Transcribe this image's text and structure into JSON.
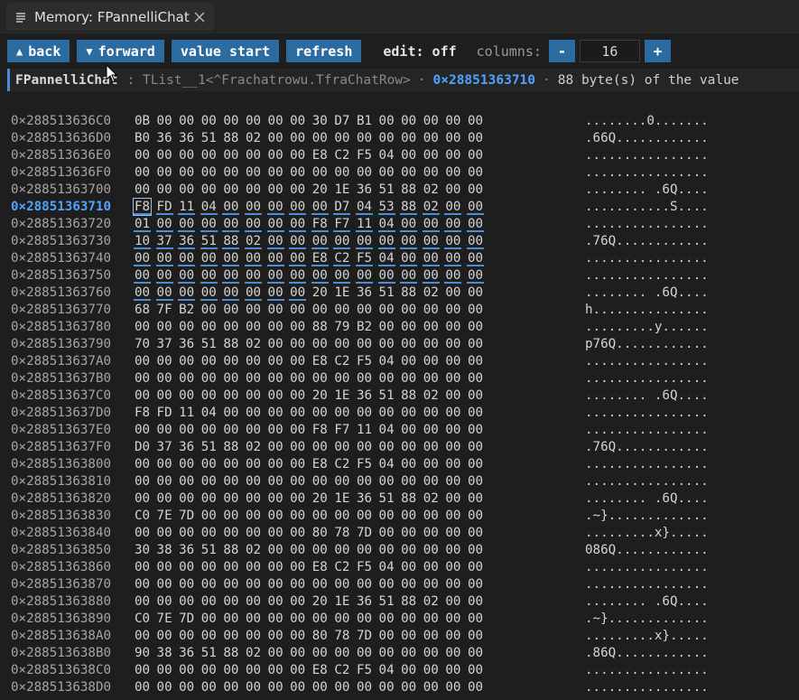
{
  "tab": {
    "title": "Memory: FPannelliChat",
    "icon": "list-icon",
    "close_icon": "close-icon"
  },
  "toolbar": {
    "back_label": "back",
    "forward_label": "forward",
    "value_start_label": "value start",
    "refresh_label": "refresh",
    "edit_label": "edit: off",
    "columns_label": "columns:",
    "columns_value": "16",
    "minus": "-",
    "plus": "+"
  },
  "infobar": {
    "name": "FPannelliChat",
    "type": ": TList__1<^Frachatrowu.TfraChatRow>",
    "address": "0×28851363710",
    "size_text": "88 byte(s) of the value",
    "dot": "·"
  },
  "colors": {
    "accent": "#2c6ba0",
    "highlight": "#4fa3ff"
  },
  "dump": {
    "current_row": 5,
    "current_byte": 0,
    "highlight_from": [
      5,
      0
    ],
    "highlight_to": [
      10,
      7
    ],
    "rows": [
      {
        "addr": "0×288513636C0",
        "bytes": [
          "0B",
          "00",
          "00",
          "00",
          "00",
          "00",
          "00",
          "00",
          "30",
          "D7",
          "B1",
          "00",
          "00",
          "00",
          "00",
          "00"
        ],
        "ascii": "........0......."
      },
      {
        "addr": "0×288513636D0",
        "bytes": [
          "B0",
          "36",
          "36",
          "51",
          "88",
          "02",
          "00",
          "00",
          "00",
          "00",
          "00",
          "00",
          "00",
          "00",
          "00",
          "00"
        ],
        "ascii": ".66Q............"
      },
      {
        "addr": "0×288513636E0",
        "bytes": [
          "00",
          "00",
          "00",
          "00",
          "00",
          "00",
          "00",
          "00",
          "E8",
          "C2",
          "F5",
          "04",
          "00",
          "00",
          "00",
          "00"
        ],
        "ascii": "................"
      },
      {
        "addr": "0×288513636F0",
        "bytes": [
          "00",
          "00",
          "00",
          "00",
          "00",
          "00",
          "00",
          "00",
          "00",
          "00",
          "00",
          "00",
          "00",
          "00",
          "00",
          "00"
        ],
        "ascii": "................"
      },
      {
        "addr": "0×28851363700",
        "bytes": [
          "00",
          "00",
          "00",
          "00",
          "00",
          "00",
          "00",
          "00",
          "20",
          "1E",
          "36",
          "51",
          "88",
          "02",
          "00",
          "00"
        ],
        "ascii": "........ .6Q...."
      },
      {
        "addr": "0×28851363710",
        "bytes": [
          "F8",
          "FD",
          "11",
          "04",
          "00",
          "00",
          "00",
          "00",
          "00",
          "D7",
          "04",
          "53",
          "88",
          "02",
          "00",
          "00"
        ],
        "ascii": "...........S...."
      },
      {
        "addr": "0×28851363720",
        "bytes": [
          "01",
          "00",
          "00",
          "00",
          "00",
          "00",
          "00",
          "00",
          "F8",
          "F7",
          "11",
          "04",
          "00",
          "00",
          "00",
          "00"
        ],
        "ascii": "................"
      },
      {
        "addr": "0×28851363730",
        "bytes": [
          "10",
          "37",
          "36",
          "51",
          "88",
          "02",
          "00",
          "00",
          "00",
          "00",
          "00",
          "00",
          "00",
          "00",
          "00",
          "00"
        ],
        "ascii": ".76Q............"
      },
      {
        "addr": "0×28851363740",
        "bytes": [
          "00",
          "00",
          "00",
          "00",
          "00",
          "00",
          "00",
          "00",
          "E8",
          "C2",
          "F5",
          "04",
          "00",
          "00",
          "00",
          "00"
        ],
        "ascii": "................"
      },
      {
        "addr": "0×28851363750",
        "bytes": [
          "00",
          "00",
          "00",
          "00",
          "00",
          "00",
          "00",
          "00",
          "00",
          "00",
          "00",
          "00",
          "00",
          "00",
          "00",
          "00"
        ],
        "ascii": "................"
      },
      {
        "addr": "0×28851363760",
        "bytes": [
          "00",
          "00",
          "00",
          "00",
          "00",
          "00",
          "00",
          "00",
          "20",
          "1E",
          "36",
          "51",
          "88",
          "02",
          "00",
          "00"
        ],
        "ascii": "........ .6Q...."
      },
      {
        "addr": "0×28851363770",
        "bytes": [
          "68",
          "7F",
          "B2",
          "00",
          "00",
          "00",
          "00",
          "00",
          "00",
          "00",
          "00",
          "00",
          "00",
          "00",
          "00",
          "00"
        ],
        "ascii": "h..............."
      },
      {
        "addr": "0×28851363780",
        "bytes": [
          "00",
          "00",
          "00",
          "00",
          "00",
          "00",
          "00",
          "00",
          "88",
          "79",
          "B2",
          "00",
          "00",
          "00",
          "00",
          "00"
        ],
        "ascii": ".........y......"
      },
      {
        "addr": "0×28851363790",
        "bytes": [
          "70",
          "37",
          "36",
          "51",
          "88",
          "02",
          "00",
          "00",
          "00",
          "00",
          "00",
          "00",
          "00",
          "00",
          "00",
          "00"
        ],
        "ascii": "p76Q............"
      },
      {
        "addr": "0×288513637A0",
        "bytes": [
          "00",
          "00",
          "00",
          "00",
          "00",
          "00",
          "00",
          "00",
          "E8",
          "C2",
          "F5",
          "04",
          "00",
          "00",
          "00",
          "00"
        ],
        "ascii": "................"
      },
      {
        "addr": "0×288513637B0",
        "bytes": [
          "00",
          "00",
          "00",
          "00",
          "00",
          "00",
          "00",
          "00",
          "00",
          "00",
          "00",
          "00",
          "00",
          "00",
          "00",
          "00"
        ],
        "ascii": "................"
      },
      {
        "addr": "0×288513637C0",
        "bytes": [
          "00",
          "00",
          "00",
          "00",
          "00",
          "00",
          "00",
          "00",
          "20",
          "1E",
          "36",
          "51",
          "88",
          "02",
          "00",
          "00"
        ],
        "ascii": "........ .6Q...."
      },
      {
        "addr": "0×288513637D0",
        "bytes": [
          "F8",
          "FD",
          "11",
          "04",
          "00",
          "00",
          "00",
          "00",
          "00",
          "00",
          "00",
          "00",
          "00",
          "00",
          "00",
          "00"
        ],
        "ascii": "................"
      },
      {
        "addr": "0×288513637E0",
        "bytes": [
          "00",
          "00",
          "00",
          "00",
          "00",
          "00",
          "00",
          "00",
          "F8",
          "F7",
          "11",
          "04",
          "00",
          "00",
          "00",
          "00"
        ],
        "ascii": "................"
      },
      {
        "addr": "0×288513637F0",
        "bytes": [
          "D0",
          "37",
          "36",
          "51",
          "88",
          "02",
          "00",
          "00",
          "00",
          "00",
          "00",
          "00",
          "00",
          "00",
          "00",
          "00"
        ],
        "ascii": ".76Q............"
      },
      {
        "addr": "0×28851363800",
        "bytes": [
          "00",
          "00",
          "00",
          "00",
          "00",
          "00",
          "00",
          "00",
          "E8",
          "C2",
          "F5",
          "04",
          "00",
          "00",
          "00",
          "00"
        ],
        "ascii": "................"
      },
      {
        "addr": "0×28851363810",
        "bytes": [
          "00",
          "00",
          "00",
          "00",
          "00",
          "00",
          "00",
          "00",
          "00",
          "00",
          "00",
          "00",
          "00",
          "00",
          "00",
          "00"
        ],
        "ascii": "................"
      },
      {
        "addr": "0×28851363820",
        "bytes": [
          "00",
          "00",
          "00",
          "00",
          "00",
          "00",
          "00",
          "00",
          "20",
          "1E",
          "36",
          "51",
          "88",
          "02",
          "00",
          "00"
        ],
        "ascii": "........ .6Q...."
      },
      {
        "addr": "0×28851363830",
        "bytes": [
          "C0",
          "7E",
          "7D",
          "00",
          "00",
          "00",
          "00",
          "00",
          "00",
          "00",
          "00",
          "00",
          "00",
          "00",
          "00",
          "00"
        ],
        "ascii": ".~}............."
      },
      {
        "addr": "0×28851363840",
        "bytes": [
          "00",
          "00",
          "00",
          "00",
          "00",
          "00",
          "00",
          "00",
          "80",
          "78",
          "7D",
          "00",
          "00",
          "00",
          "00",
          "00"
        ],
        "ascii": ".........x}....."
      },
      {
        "addr": "0×28851363850",
        "bytes": [
          "30",
          "38",
          "36",
          "51",
          "88",
          "02",
          "00",
          "00",
          "00",
          "00",
          "00",
          "00",
          "00",
          "00",
          "00",
          "00"
        ],
        "ascii": "086Q............"
      },
      {
        "addr": "0×28851363860",
        "bytes": [
          "00",
          "00",
          "00",
          "00",
          "00",
          "00",
          "00",
          "00",
          "E8",
          "C2",
          "F5",
          "04",
          "00",
          "00",
          "00",
          "00"
        ],
        "ascii": "................"
      },
      {
        "addr": "0×28851363870",
        "bytes": [
          "00",
          "00",
          "00",
          "00",
          "00",
          "00",
          "00",
          "00",
          "00",
          "00",
          "00",
          "00",
          "00",
          "00",
          "00",
          "00"
        ],
        "ascii": "................"
      },
      {
        "addr": "0×28851363880",
        "bytes": [
          "00",
          "00",
          "00",
          "00",
          "00",
          "00",
          "00",
          "00",
          "20",
          "1E",
          "36",
          "51",
          "88",
          "02",
          "00",
          "00"
        ],
        "ascii": "........ .6Q...."
      },
      {
        "addr": "0×28851363890",
        "bytes": [
          "C0",
          "7E",
          "7D",
          "00",
          "00",
          "00",
          "00",
          "00",
          "00",
          "00",
          "00",
          "00",
          "00",
          "00",
          "00",
          "00"
        ],
        "ascii": ".~}............."
      },
      {
        "addr": "0×288513638A0",
        "bytes": [
          "00",
          "00",
          "00",
          "00",
          "00",
          "00",
          "00",
          "00",
          "80",
          "78",
          "7D",
          "00",
          "00",
          "00",
          "00",
          "00"
        ],
        "ascii": ".........x}....."
      },
      {
        "addr": "0×288513638B0",
        "bytes": [
          "90",
          "38",
          "36",
          "51",
          "88",
          "02",
          "00",
          "00",
          "00",
          "00",
          "00",
          "00",
          "00",
          "00",
          "00",
          "00"
        ],
        "ascii": ".86Q............"
      },
      {
        "addr": "0×288513638C0",
        "bytes": [
          "00",
          "00",
          "00",
          "00",
          "00",
          "00",
          "00",
          "00",
          "E8",
          "C2",
          "F5",
          "04",
          "00",
          "00",
          "00",
          "00"
        ],
        "ascii": "................"
      },
      {
        "addr": "0×288513638D0",
        "bytes": [
          "00",
          "00",
          "00",
          "00",
          "00",
          "00",
          "00",
          "00",
          "00",
          "00",
          "00",
          "00",
          "00",
          "00",
          "00",
          "00"
        ],
        "ascii": "................"
      }
    ]
  }
}
